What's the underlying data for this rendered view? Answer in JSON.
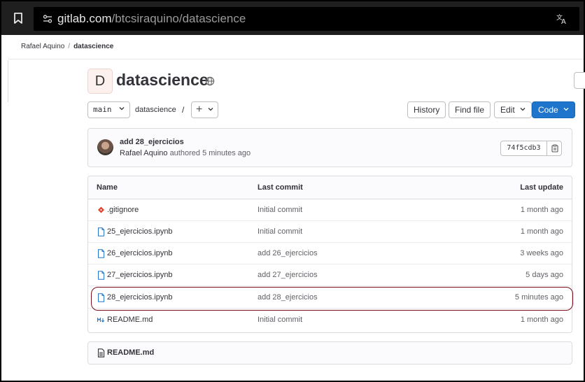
{
  "browser": {
    "url_host": "gitlab.com",
    "url_path": "/btcsiraquino/datascience"
  },
  "breadcrumb": {
    "items": [
      "Rafael Aquino",
      "datascience"
    ]
  },
  "project": {
    "avatar_letter": "D",
    "name": "datascience"
  },
  "toolbar": {
    "branch": "main",
    "path": "datascience",
    "path_sep": "/",
    "add_label": "+",
    "history_label": "History",
    "find_file_label": "Find file",
    "edit_label": "Edit",
    "code_label": "Code"
  },
  "last_commit": {
    "message": "add 28_ejercicios",
    "author": "Rafael Aquino",
    "action": "authored",
    "time": "5 minutes ago",
    "sha": "74f5cdb3"
  },
  "file_table": {
    "headers": {
      "name": "Name",
      "last_commit": "Last commit",
      "last_update": "Last update"
    },
    "rows": [
      {
        "name": ".gitignore",
        "icon": "git-icon",
        "commit": "Initial commit",
        "updated": "1 month ago"
      },
      {
        "name": "25_ejercicios.ipynb",
        "icon": "file-icon",
        "commit": "Initial commit",
        "updated": "1 month ago"
      },
      {
        "name": "26_ejercicios.ipynb",
        "icon": "file-icon",
        "commit": "add 26_ejercicios",
        "updated": "3 weeks ago"
      },
      {
        "name": "27_ejercicios.ipynb",
        "icon": "file-icon",
        "commit": "add 27_ejercicios",
        "updated": "5 days ago"
      },
      {
        "name": "28_ejercicios.ipynb",
        "icon": "file-icon",
        "commit": "add 28_ejercicios",
        "updated": "5 minutes ago"
      },
      {
        "name": "README.md",
        "icon": "markdown-icon",
        "commit": "Initial commit",
        "updated": "1 month ago"
      }
    ]
  },
  "readme": {
    "title": "README.md"
  },
  "colors": {
    "primary_button": "#1f75cb",
    "highlight_outline": "#7a0f1a",
    "git_icon": "#e24329",
    "file_icon": "#1f75cb",
    "markdown_icon": "#1f75cb"
  }
}
